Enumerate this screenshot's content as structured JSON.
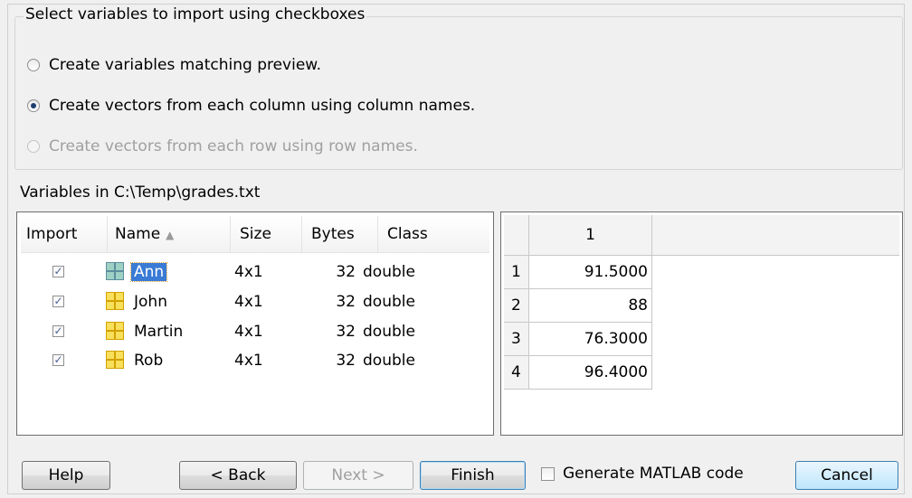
{
  "group": {
    "title": "Select variables to import using checkboxes",
    "options": [
      {
        "label": "Create variables matching preview.",
        "selected": false,
        "enabled": true
      },
      {
        "label": "Create vectors from each column using column names.",
        "selected": true,
        "enabled": true
      },
      {
        "label": "Create vectors from each row using row names.",
        "selected": false,
        "enabled": false
      }
    ]
  },
  "variables": {
    "label": "Variables in C:\\Temp\\grades.txt",
    "columns": {
      "import": "Import",
      "name": "Name",
      "size": "Size",
      "bytes": "Bytes",
      "class": "Class"
    },
    "rows": [
      {
        "checked": true,
        "name": "Ann",
        "size": "4x1",
        "bytes": "32",
        "class": "double",
        "selected": true
      },
      {
        "checked": true,
        "name": "John",
        "size": "4x1",
        "bytes": "32",
        "class": "double",
        "selected": false
      },
      {
        "checked": true,
        "name": "Martin",
        "size": "4x1",
        "bytes": "32",
        "class": "double",
        "selected": false
      },
      {
        "checked": true,
        "name": "Rob",
        "size": "4x1",
        "bytes": "32",
        "class": "double",
        "selected": false
      }
    ]
  },
  "preview": {
    "column_header": "1",
    "rows": [
      {
        "index": "1",
        "value": "91.5000"
      },
      {
        "index": "2",
        "value": "88"
      },
      {
        "index": "3",
        "value": "76.3000"
      },
      {
        "index": "4",
        "value": "96.4000"
      }
    ]
  },
  "buttons": {
    "help": "Help",
    "back": "< Back",
    "next": "Next >",
    "finish": "Finish",
    "generate_code": "Generate MATLAB code",
    "cancel": "Cancel"
  }
}
